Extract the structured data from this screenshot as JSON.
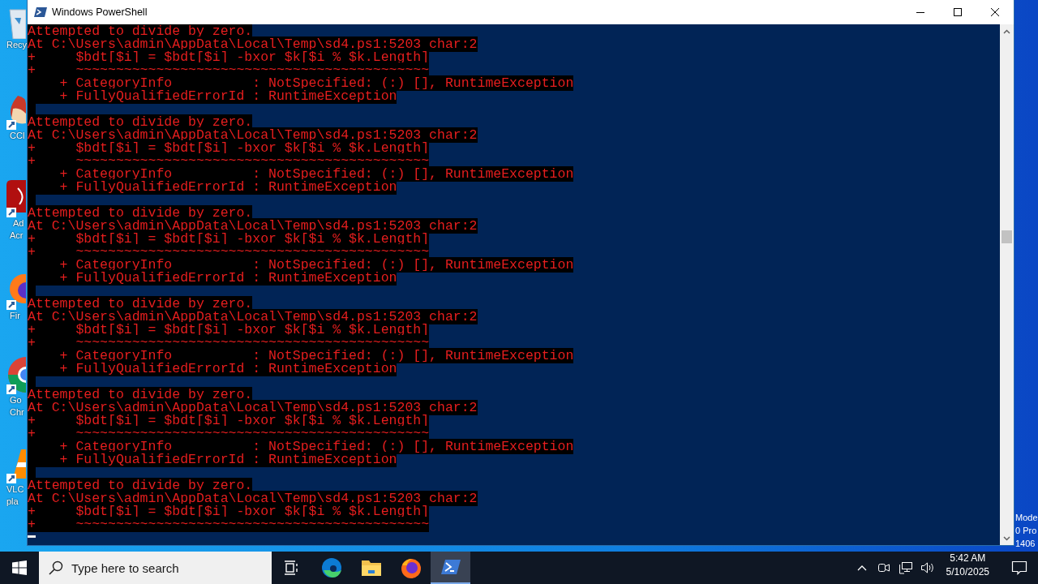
{
  "desktop": {
    "icons": [
      {
        "kind": "bin",
        "lines": [
          "Recy"
        ]
      },
      {
        "kind": "cleaner",
        "lines": [
          "CCl"
        ]
      },
      {
        "kind": "pdf",
        "lines": [
          "Ad",
          "Acr"
        ]
      },
      {
        "kind": "fox",
        "lines": [
          "Fir"
        ]
      },
      {
        "kind": "globe",
        "lines": [
          "Go",
          "Chr"
        ]
      },
      {
        "kind": "cone",
        "lines": [
          "VLC",
          "pla"
        ]
      }
    ],
    "edition_lines": [
      "Mode",
      "0 Pro",
      "1406"
    ]
  },
  "window": {
    "title": "Windows PowerShell"
  },
  "console": {
    "entries": [
      {
        "lines": [
          "Attempted to divide by zero.",
          "At C:\\Users\\admin\\AppData\\Local\\Temp\\sd4.ps1:5203 char:2",
          "+     $bdt[$i] = $bdt[$i] -bxor $k[$i % $k.Length]",
          "+     ~~~~~~~~~~~~~~~~~~~~~~~~~~~~~~~~~~~~~~~~~~~~",
          "    + CategoryInfo          : NotSpecified: (:) [], RuntimeException",
          "    + FullyQualifiedErrorId : RuntimeException"
        ]
      },
      {
        "lines": [
          "Attempted to divide by zero.",
          "At C:\\Users\\admin\\AppData\\Local\\Temp\\sd4.ps1:5203 char:2",
          "+     $bdt[$i] = $bdt[$i] -bxor $k[$i % $k.Length]",
          "+     ~~~~~~~~~~~~~~~~~~~~~~~~~~~~~~~~~~~~~~~~~~~~",
          "    + CategoryInfo          : NotSpecified: (:) [], RuntimeException",
          "    + FullyQualifiedErrorId : RuntimeException"
        ]
      },
      {
        "lines": [
          "Attempted to divide by zero.",
          "At C:\\Users\\admin\\AppData\\Local\\Temp\\sd4.ps1:5203 char:2",
          "+     $bdt[$i] = $bdt[$i] -bxor $k[$i % $k.Length]",
          "+     ~~~~~~~~~~~~~~~~~~~~~~~~~~~~~~~~~~~~~~~~~~~~",
          "    + CategoryInfo          : NotSpecified: (:) [], RuntimeException",
          "    + FullyQualifiedErrorId : RuntimeException"
        ]
      },
      {
        "lines": [
          "Attempted to divide by zero.",
          "At C:\\Users\\admin\\AppData\\Local\\Temp\\sd4.ps1:5203 char:2",
          "+     $bdt[$i] = $bdt[$i] -bxor $k[$i % $k.Length]",
          "+     ~~~~~~~~~~~~~~~~~~~~~~~~~~~~~~~~~~~~~~~~~~~~",
          "    + CategoryInfo          : NotSpecified: (:) [], RuntimeException",
          "    + FullyQualifiedErrorId : RuntimeException"
        ]
      },
      {
        "lines": [
          "Attempted to divide by zero.",
          "At C:\\Users\\admin\\AppData\\Local\\Temp\\sd4.ps1:5203 char:2",
          "+     $bdt[$i] = $bdt[$i] -bxor $k[$i % $k.Length]",
          "+     ~~~~~~~~~~~~~~~~~~~~~~~~~~~~~~~~~~~~~~~~~~~~",
          "    + CategoryInfo          : NotSpecified: (:) [], RuntimeException",
          "    + FullyQualifiedErrorId : RuntimeException"
        ]
      },
      {
        "lines": [
          "Attempted to divide by zero.",
          "At C:\\Users\\admin\\AppData\\Local\\Temp\\sd4.ps1:5203 char:2",
          "+     $bdt[$i] = $bdt[$i] -bxor $k[$i % $k.Length]",
          "+     ~~~~~~~~~~~~~~~~~~~~~~~~~~~~~~~~~~~~~~~~~~~~"
        ]
      }
    ]
  },
  "taskbar": {
    "search": {
      "placeholder": "Type here to search"
    },
    "apps": [
      {
        "kind": "taskview",
        "selected": false
      },
      {
        "kind": "edge",
        "selected": false
      },
      {
        "kind": "folder",
        "selected": false
      },
      {
        "kind": "fox",
        "selected": false
      },
      {
        "kind": "shell",
        "selected": true
      }
    ],
    "clock": {
      "time": "5:42 AM",
      "date": "5/10/2025"
    }
  }
}
